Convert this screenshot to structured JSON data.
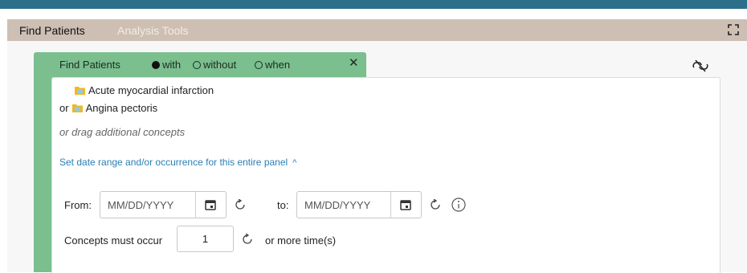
{
  "tabs": {
    "find_patients": "Find Patients",
    "analysis_tools": "Analysis Tools"
  },
  "panel": {
    "title": "Find Patients",
    "options": {
      "with": "with",
      "without": "without",
      "when": "when"
    },
    "selected_option": "with",
    "close": "✕"
  },
  "concepts": [
    {
      "prefix": "",
      "name": "Acute myocardial infarction"
    },
    {
      "prefix": "or",
      "name": "Angina pectoris"
    }
  ],
  "drag_hint": "or drag additional concepts",
  "date_toggle": {
    "label": "Set date range and/or occurrence for this entire panel",
    "chevron": "^"
  },
  "date_range": {
    "from_label": "From:",
    "from_placeholder": "MM/DD/YYYY",
    "to_label": "to:",
    "to_placeholder": "MM/DD/YYYY"
  },
  "occurrence": {
    "label": "Concepts must occur",
    "value": "1",
    "suffix": "or more time(s)"
  },
  "icons": {
    "expand": "expand-icon",
    "unlink": "unlink-icon",
    "folder": "folder-icon",
    "calendar": "calendar-icon",
    "reset": "reset-icon",
    "info": "info-icon"
  },
  "colors": {
    "top_bar": "#2b6f8a",
    "tab_bar": "#cdbfb3",
    "panel_green": "#7bbf8f",
    "link_blue": "#2a7fb4"
  }
}
